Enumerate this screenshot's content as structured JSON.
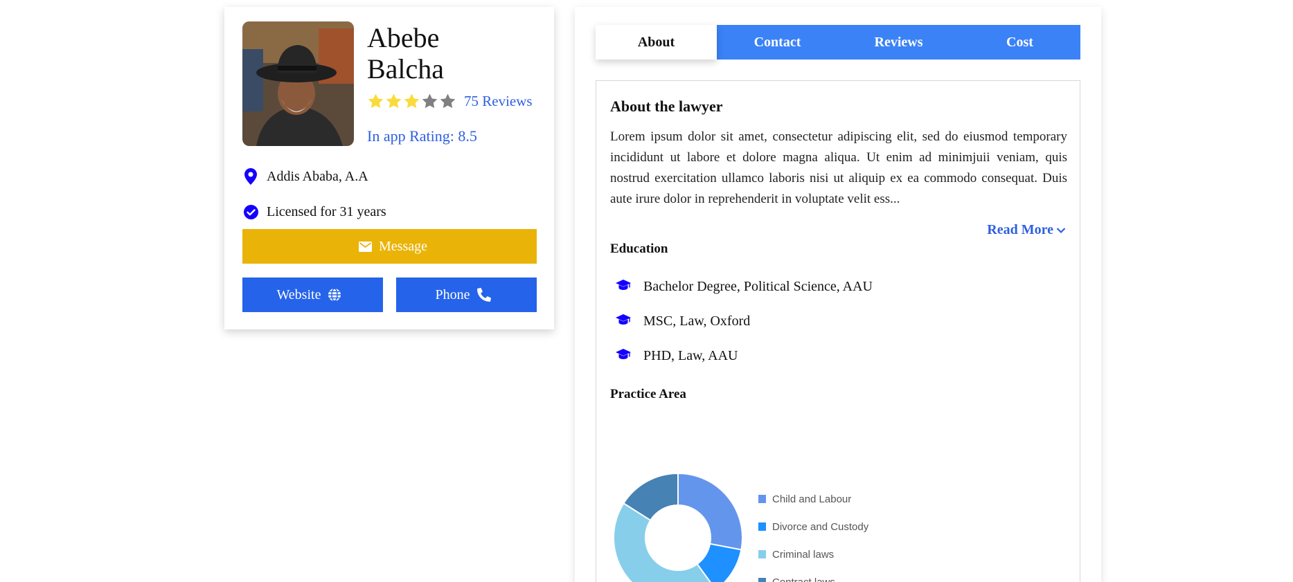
{
  "profile": {
    "first_name": "Abebe",
    "last_name": "Balcha",
    "stars_filled": 3,
    "stars_total": 5,
    "reviews_text": "75 Reviews",
    "app_rating_text": "In app Rating: 8.5",
    "location": "Addis Ababa, A.A",
    "licensed": "Licensed for 31 years",
    "buttons": {
      "message": "Message",
      "website": "Website",
      "phone": "Phone"
    }
  },
  "tabs": [
    {
      "label": "About",
      "active": true
    },
    {
      "label": "Contact",
      "active": false
    },
    {
      "label": "Reviews",
      "active": false
    },
    {
      "label": "Cost",
      "active": false
    }
  ],
  "about": {
    "title": "About the lawyer",
    "text": "Lorem ipsum dolor sit amet, consectetur adipiscing elit, sed do eiusmod temporary incididunt ut labore et dolore magna aliqua. Ut enim ad minimjuii veniam, quis nostrud exercitation ullamco laboris nisi ut aliquip ex ea commodo consequat. Duis aute irure dolor in reprehenderit in voluptate velit ess...",
    "read_more": "Read More"
  },
  "education": {
    "title": "Education",
    "items": [
      "Bachelor Degree, Political Science, AAU",
      "MSC, Law, Oxford",
      "PHD, Law, AAU"
    ]
  },
  "practice": {
    "title": "Practice Area"
  },
  "colors": {
    "star_filled": "#fadb3c",
    "star_empty": "#808080",
    "link_blue": "#2f5fe0",
    "message_yellow": "#eab308",
    "button_blue": "#2563eb",
    "tab_blue": "#3b82f6",
    "icon_blue": "#1400ff"
  },
  "chart_data": {
    "type": "pie",
    "donut": true,
    "legend_position": "right",
    "categories": [
      "Child and Labour",
      "Divorce and Custody",
      "Criminal laws",
      "Contract laws"
    ],
    "values": [
      28,
      12,
      44,
      16
    ],
    "colors": [
      "#6495ed",
      "#1e90ff",
      "#87ceeb",
      "#4682b4"
    ]
  }
}
